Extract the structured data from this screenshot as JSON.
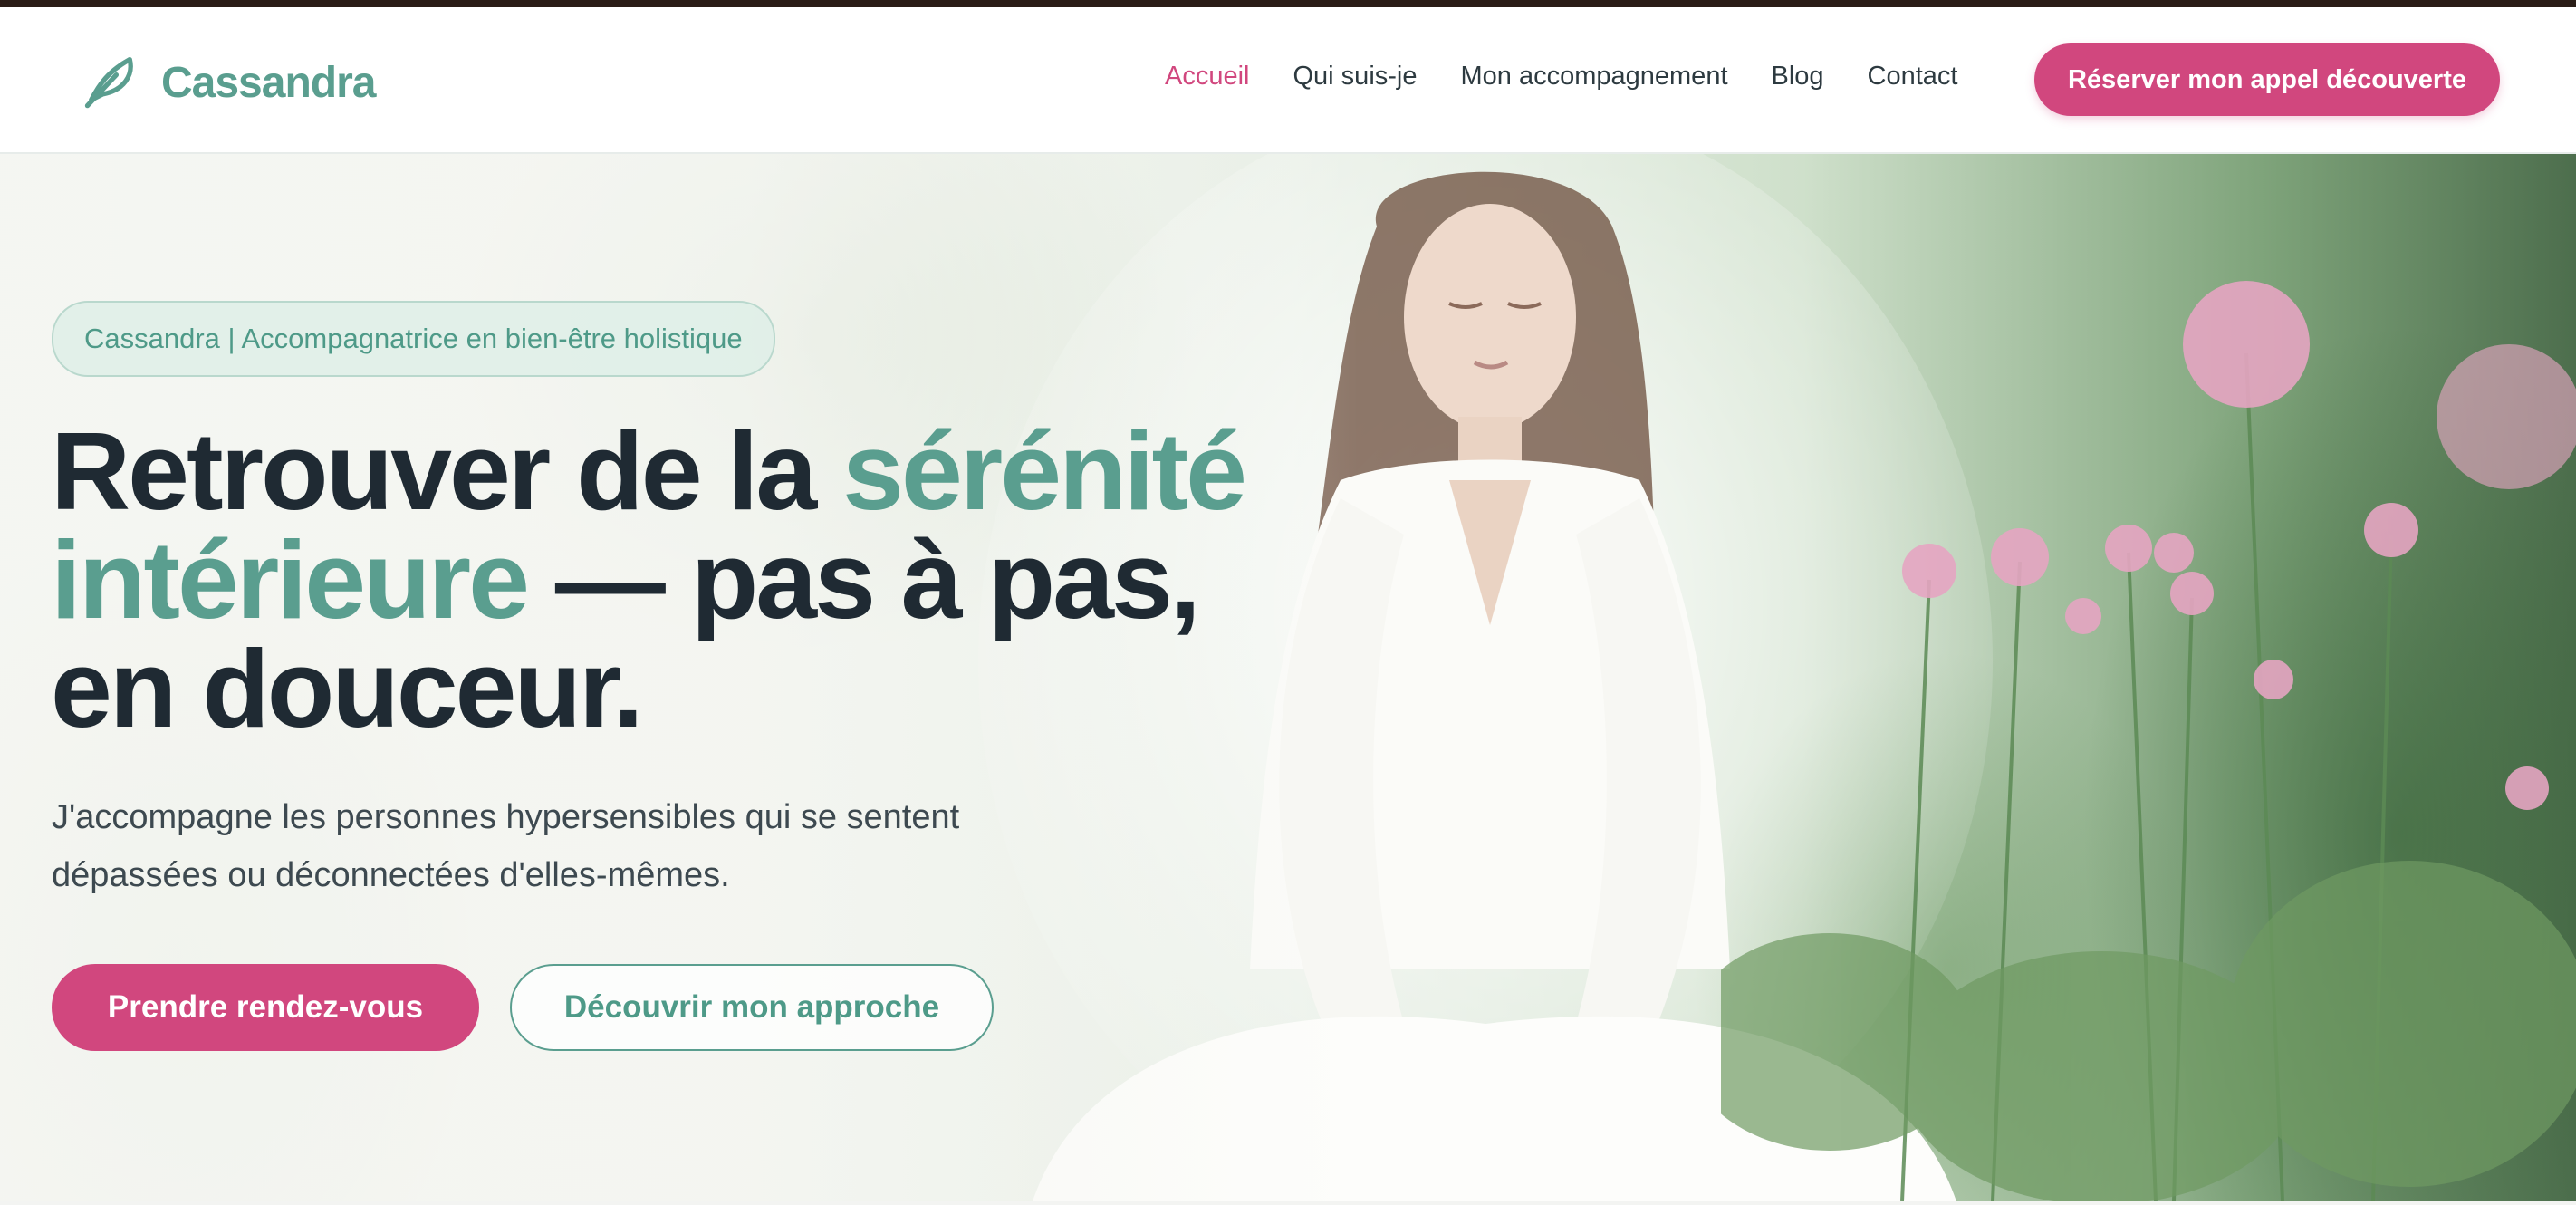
{
  "header": {
    "logo_text": "Cassandra",
    "logo_icon": "feather-icon",
    "nav": [
      {
        "label": "Accueil",
        "active": true
      },
      {
        "label": "Qui suis-je",
        "active": false
      },
      {
        "label": "Mon accompagnement",
        "active": false
      },
      {
        "label": "Blog",
        "active": false
      },
      {
        "label": "Contact",
        "active": false
      }
    ],
    "cta_label": "Réserver mon appel découverte"
  },
  "hero": {
    "tagline": "Cassandra | Accompagnatrice en bien-être holistique",
    "headline": {
      "part1": "Retrouver de la ",
      "accent1": "sérénité",
      "accent2": "intérieure",
      "part2": " — pas à pas,",
      "part3": "en douceur."
    },
    "subtitle_line1": "J'accompagne les personnes hypersensibles qui se sentent",
    "subtitle_line2": "dépassées ou déconnectées d'elles-mêmes.",
    "primary_button": "Prendre rendez-vous",
    "secondary_button": "Découvrir mon approche"
  },
  "colors": {
    "brand_green": "#5a9e8f",
    "brand_pink": "#d1477e",
    "text_dark": "#1f2a33"
  }
}
